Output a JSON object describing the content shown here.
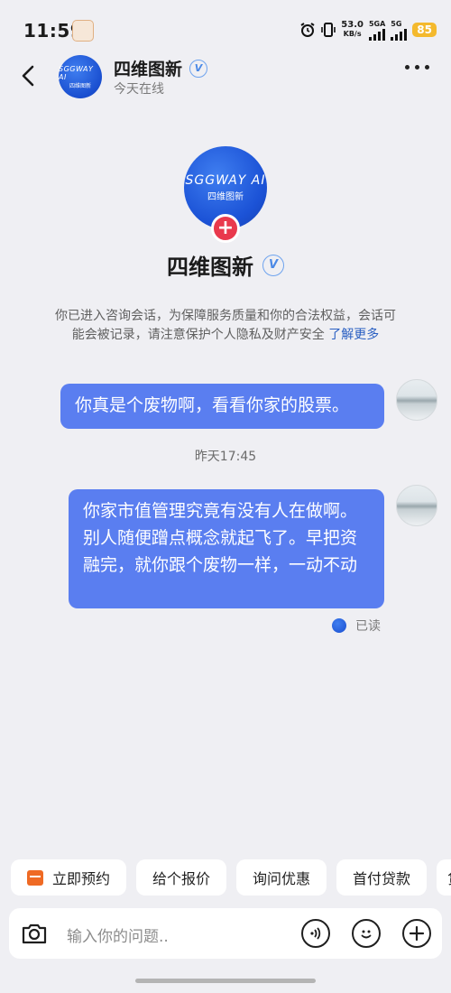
{
  "status_bar": {
    "time": "11:59",
    "net_speed_value": "53.0",
    "net_speed_unit": "KB/s",
    "network_1": "5GA",
    "network_2": "5G",
    "battery": "85"
  },
  "header": {
    "name": "四维图新",
    "status": "今天在线",
    "logo_text": "SGGWAY AI",
    "logo_sub": "四维图新"
  },
  "profile": {
    "name": "四维图新",
    "logo_text": "SGGWAY AI",
    "logo_sub": "四维图新",
    "notice": "你已进入咨询会话，为保障服务质量和你的合法权益，会话可能会被记录，请注意保护个人隐私及财产安全 ",
    "notice_link": "了解更多"
  },
  "messages": [
    {
      "text": "你真是个废物啊，看看你家的股票。"
    },
    {
      "timestamp": "昨天17:45"
    },
    {
      "text": "你家市值管理究竟有没有人在做啊。别人随便蹭点概念就起飞了。早把资融完，就你跟个废物一样，一动不动",
      "read_status": "已读"
    }
  ],
  "quick_replies": [
    "立即预约",
    "给个报价",
    "询问优惠",
    "首付贷款",
    "贷"
  ],
  "input": {
    "placeholder": "输入你的问题.."
  },
  "colors": {
    "bubble": "#5a7ef0",
    "background": "#efeff3",
    "accent_red": "#e9394d",
    "link": "#2a5fc2"
  },
  "icons": [
    "back-arrow-icon",
    "verified-icon",
    "more-icon",
    "add-icon",
    "calendar-icon",
    "camera-icon",
    "voice-icon",
    "emoji-icon",
    "plus-icon"
  ]
}
